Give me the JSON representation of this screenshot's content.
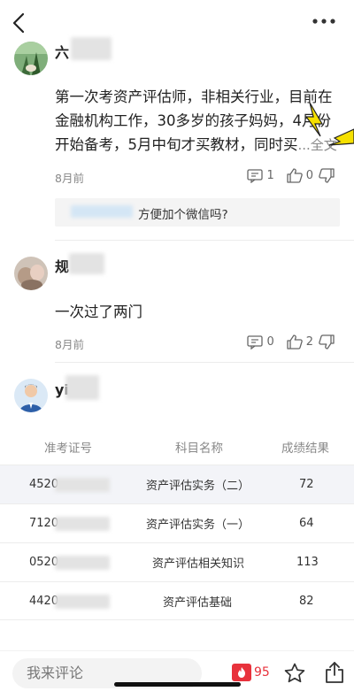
{
  "comments": [
    {
      "name": "六",
      "body_lines": [
        "第一次考资产评估师，非相关行业，目前在",
        "金融机构工作，30多岁的孩子妈妈，4月份",
        "开始备考，5月中旬才买教材，同时买"
      ],
      "more_label": "...全文",
      "time": "8月前",
      "reply_count": "1",
      "like_count": "0",
      "reply_text": "方便加个微信吗?"
    },
    {
      "name": "规",
      "body": "一次过了两门",
      "time": "8月前",
      "reply_count": "0",
      "like_count": "2"
    },
    {
      "name": "yi"
    }
  ],
  "score_table": {
    "headers": [
      "准考证号",
      "科目名称",
      "成绩结果"
    ],
    "rows": [
      {
        "id": "4520",
        "subject": "资产评估实务（二）",
        "score": "72"
      },
      {
        "id": "7120",
        "subject": "资产评估实务（一）",
        "score": "64"
      },
      {
        "id": "0520",
        "subject": "资产评估相关知识",
        "score": "113"
      },
      {
        "id": "4420",
        "subject": "资产评估基础",
        "score": "82"
      }
    ]
  },
  "bottom_bar": {
    "comment_placeholder": "我来评论",
    "hot_count": "95"
  },
  "colors": {
    "accent_red": "#e8323c",
    "muted_text": "#888888",
    "arrow_yellow": "#f5e000"
  },
  "icons": [
    "back-icon",
    "more-icon",
    "comment-icon",
    "thumbs-up-icon",
    "thumbs-down-icon",
    "hot-icon",
    "star-icon",
    "share-icon"
  ]
}
